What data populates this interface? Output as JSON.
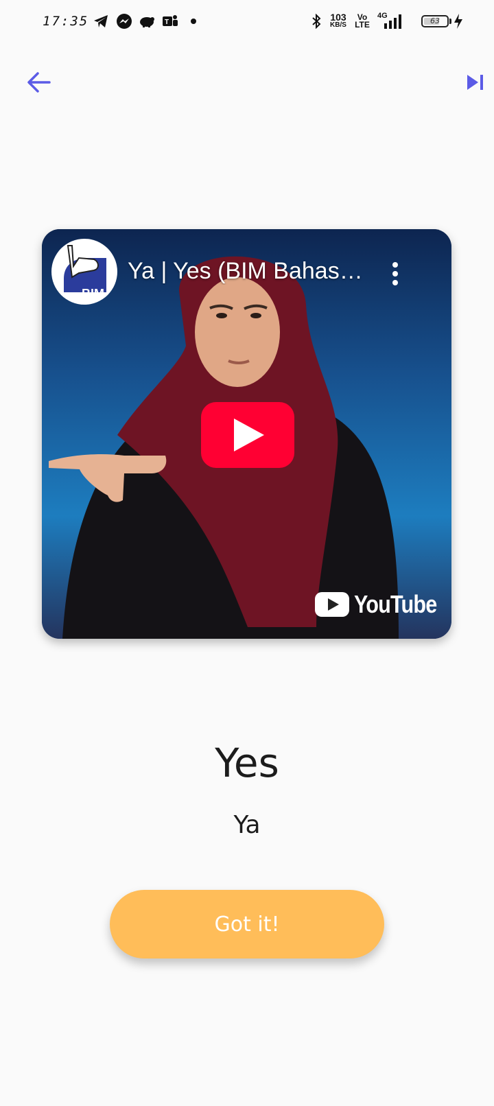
{
  "status_bar": {
    "time": "17:35",
    "net_speed_value": "103",
    "net_speed_unit": "KB/S",
    "volte_top": "Vo",
    "volte_bottom": "LTE",
    "network": "4G",
    "battery_level": "63",
    "icons": [
      "telegram-icon",
      "messenger-icon",
      "piggy-bank-icon",
      "teams-icon",
      "dot-icon",
      "bluetooth-icon",
      "signal-icon",
      "battery-icon",
      "charging-icon"
    ]
  },
  "nav": {
    "back_icon": "arrow-left-icon",
    "skip_icon": "skip-next-icon",
    "accent_color": "#5b5be6"
  },
  "video": {
    "title": "Ya | Yes (BIM Bahasa Isyarat Malaysia)",
    "channel_logo_text": "BIM",
    "platform": "YouTube",
    "play_color": "#ff0033"
  },
  "word": {
    "english": "Yes",
    "malay": "Ya"
  },
  "actions": {
    "got_it_label": "Got it!",
    "button_color": "#ffbd59"
  }
}
